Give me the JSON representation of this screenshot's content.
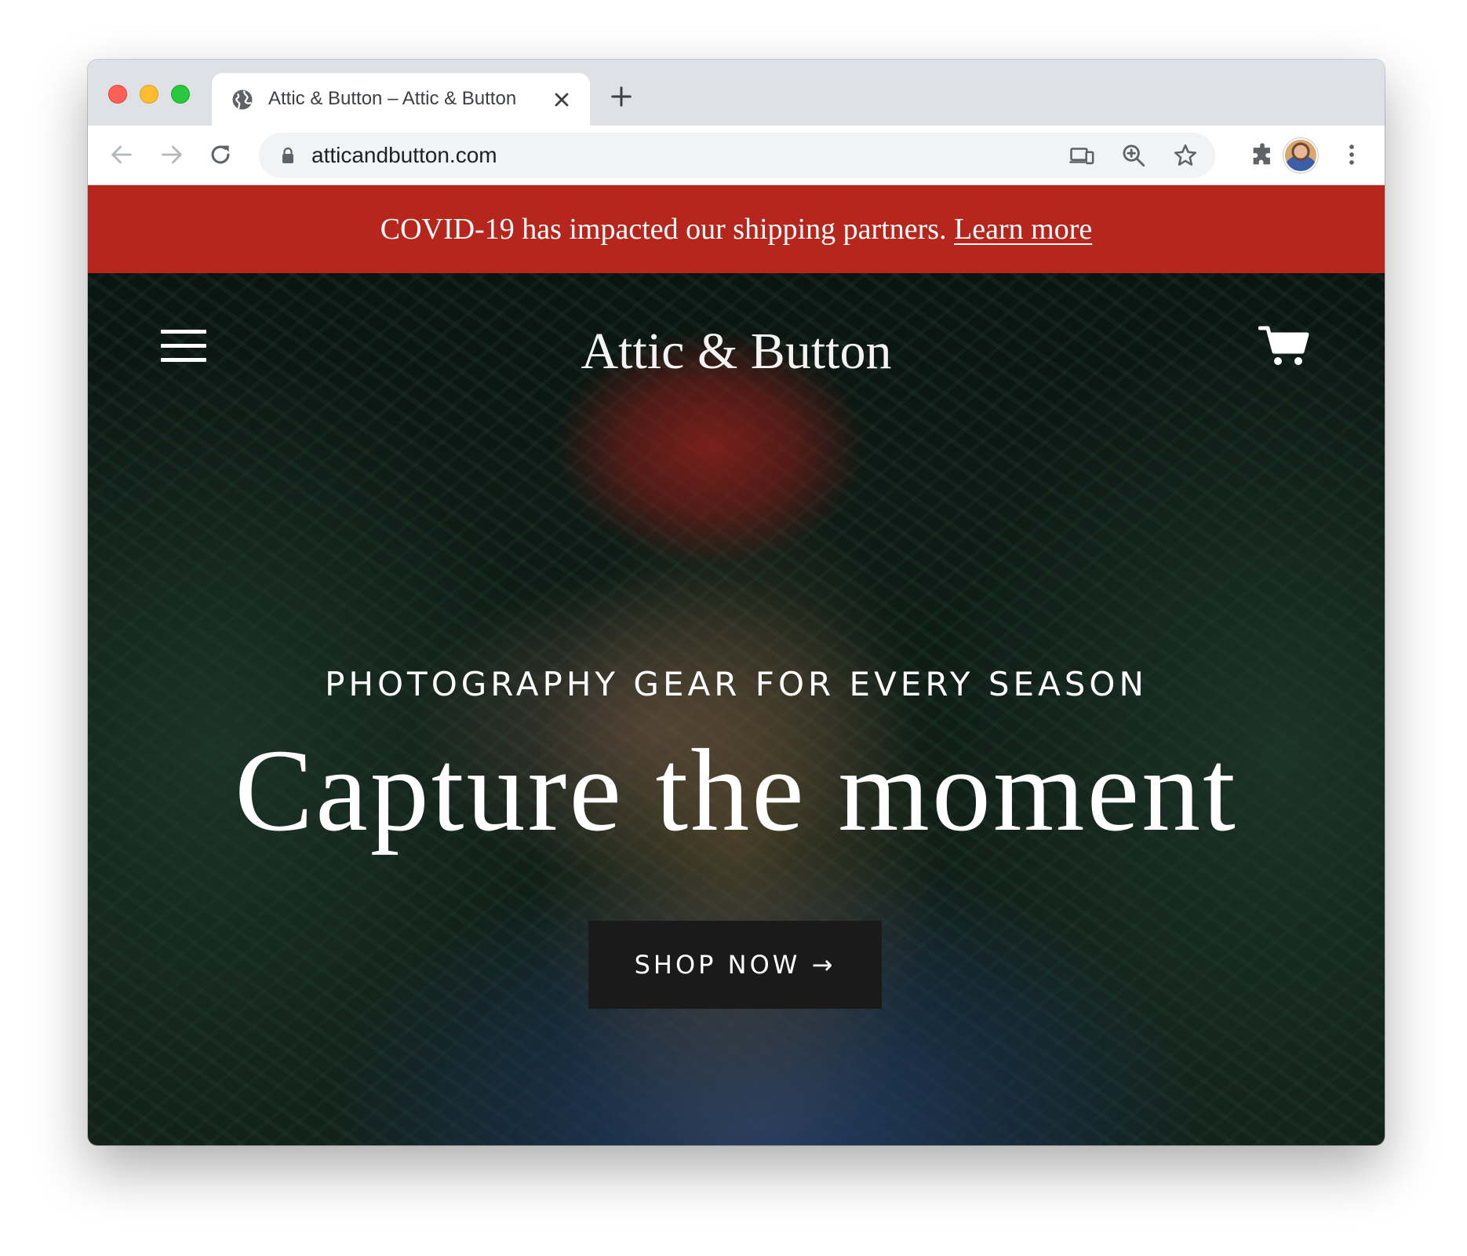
{
  "browser": {
    "tab": {
      "title": "Attic & Button – Attic & Button",
      "favicon_icon": "globe-icon"
    },
    "address_bar": {
      "url": "atticandbutton.com"
    },
    "icons": {
      "back": "arrow-left-icon",
      "forward": "arrow-right-icon",
      "reload": "reload-icon",
      "lock": "lock-icon",
      "cast": "cast-icon",
      "zoom": "zoom-in-icon",
      "bookmark": "star-icon",
      "extensions": "puzzle-icon",
      "profile": "avatar",
      "menu": "more-vertical-icon"
    }
  },
  "announcement": {
    "text": "COVID-19 has impacted our shipping partners.",
    "link_label": "Learn more",
    "background_color": "#b7261c"
  },
  "header": {
    "logo_text": "Attic & Button",
    "menu_icon": "hamburger-icon",
    "cart_icon": "cart-icon"
  },
  "hero": {
    "kicker": "PHOTOGRAPHY GEAR FOR EVERY SEASON",
    "headline": "Capture the moment",
    "cta_label": "SHOP NOW →",
    "cta_color": "#1a1a1a"
  }
}
